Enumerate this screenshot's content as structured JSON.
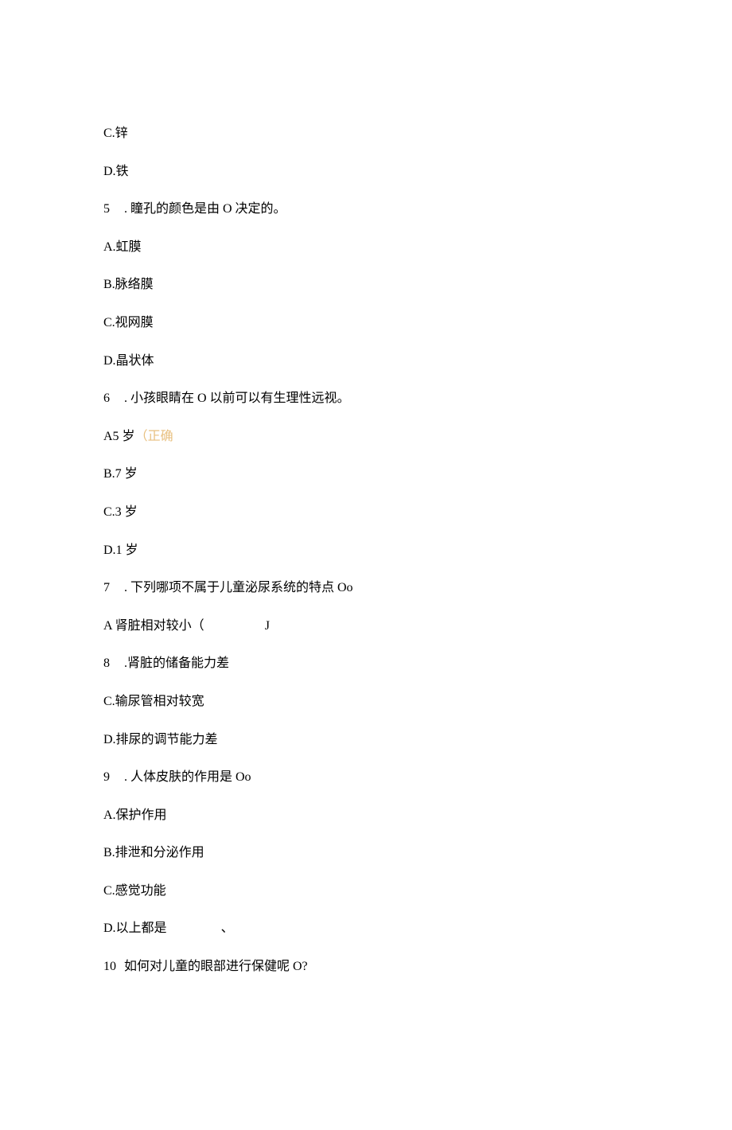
{
  "q4": {
    "optC": "C.锌",
    "optD": "D.铁"
  },
  "q5": {
    "num": "5",
    "stem": ". 瞳孔的颜色是由 O 决定的。",
    "optA": "A.虹膜",
    "optB": "B.脉络膜",
    "optC": "C.视网膜",
    "optD": "D.晶状体"
  },
  "q6": {
    "num": "6",
    "stem": ". 小孩眼睛在 O 以前可以有生理性远视。",
    "optA": "A5 岁",
    "optA_note": "（正确",
    "optB": "B.7 岁",
    "optC": "C.3 岁",
    "optD": "D.1 岁"
  },
  "q7": {
    "num": "7",
    "stem": ". 下列哪项不属于儿童泌尿系统的特点 Oo",
    "optA_prefix": "A 肾脏相对较小（",
    "optA_suffix": "J",
    "num8": "8",
    "optB": ".肾脏的储备能力差",
    "optC": "C.输尿管相对较宽",
    "optD": "D.排尿的调节能力差"
  },
  "q9": {
    "num": "9",
    "stem": ". 人体皮肤的作用是 Oo",
    "optA": "A.保护作用",
    "optB": "B.排泄和分泌作用",
    "optC": "C.感觉功能",
    "optD_prefix": "D.以上都是",
    "optD_suffix": "、"
  },
  "q10": {
    "num": "10",
    "stem": "如何对儿童的眼部进行保健呢 O?"
  }
}
